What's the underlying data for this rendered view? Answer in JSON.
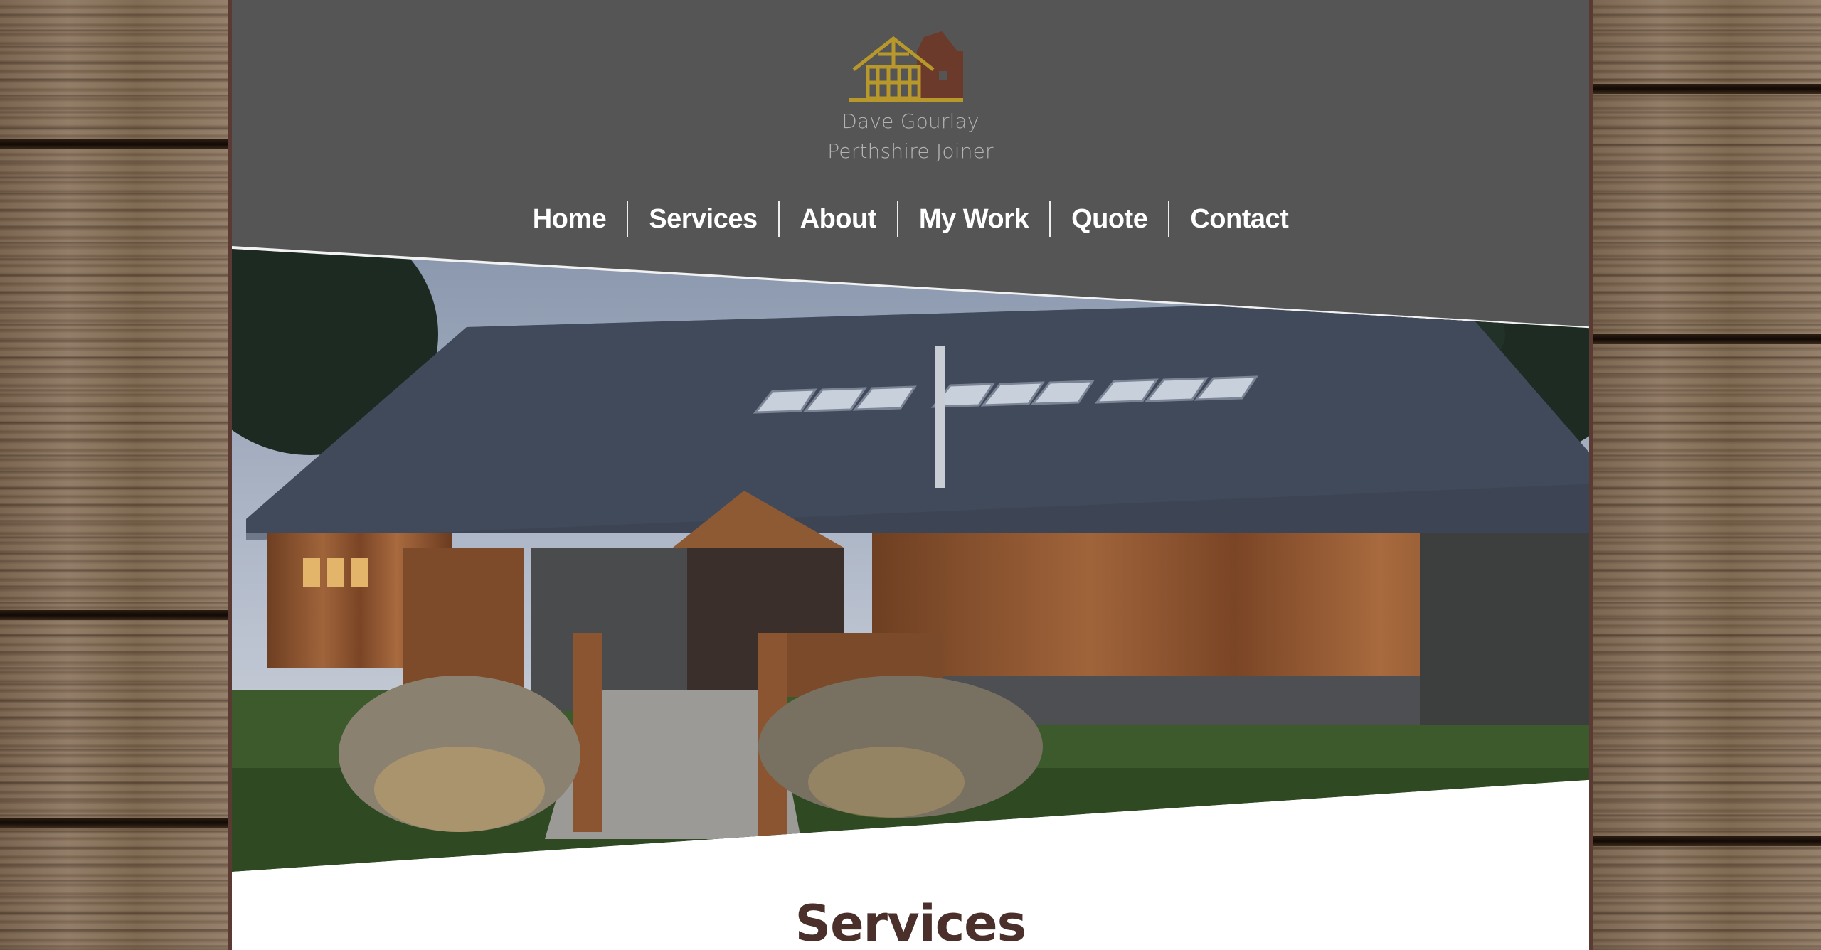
{
  "brand": {
    "name": "Dave Gourlay",
    "tagline": "Perthshire Joiner"
  },
  "nav": {
    "items": [
      {
        "label": "Home"
      },
      {
        "label": "Services"
      },
      {
        "label": "About"
      },
      {
        "label": "My Work"
      },
      {
        "label": "Quote"
      },
      {
        "label": "Contact"
      }
    ]
  },
  "hero": {
    "image": "timber-clad-building-photo"
  },
  "content": {
    "section_title": "Services"
  },
  "colors": {
    "header_bg": "#555555",
    "frame_border": "#5b3a33",
    "logo_gold": "#b8982a",
    "logo_brown": "#6b3a2a",
    "title_color": "#4a2f2a"
  }
}
